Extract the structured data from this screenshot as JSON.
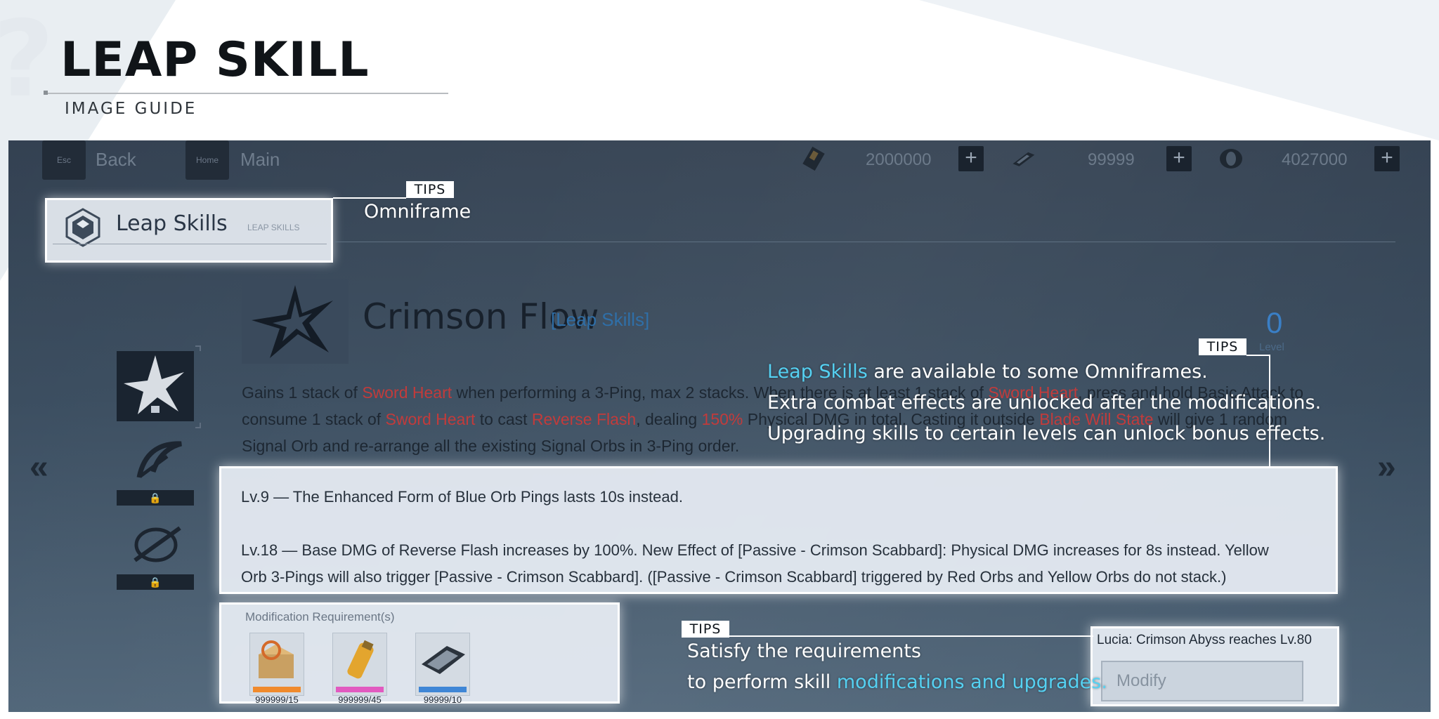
{
  "guide": {
    "title": "LEAP SKILL",
    "subtitle": "IMAGE GUIDE"
  },
  "topbar": {
    "back_key": "Esc",
    "back_label": "Back",
    "main_key": "Home",
    "main_label": "Main",
    "resources": [
      {
        "icon": "currency-card-icon",
        "value": "2000000"
      },
      {
        "icon": "currency-chip-icon",
        "value": "99999"
      },
      {
        "icon": "currency-coin-icon",
        "value": "4027000"
      }
    ]
  },
  "tab": {
    "label": "Leap Skills",
    "sublabel": "LEAP SKILLS"
  },
  "skill": {
    "name": "Crimson Flow",
    "tag": "[Leap Skills]",
    "level": "0",
    "level_label": "Level",
    "desc": {
      "p1": "Gains 1 stack of ",
      "k1": "Sword Heart",
      "p2": " when performing a 3-Ping, max 2 stacks. When there is at least 1 stack of ",
      "k2": "Sword Heart",
      "p3": ", press and hold Basic Attack to consume 1 stack of ",
      "k3": "Sword Heart",
      "p4": " to cast ",
      "k4": "Reverse Flash",
      "p5": ", dealing ",
      "k5": "150%",
      "p6": " Physical DMG in total. Casting it outside ",
      "k6": "Blade Will State",
      "p7": " will give 1 random Signal Orb and re-arrange all the existing Signal Orbs in 3-Ping order."
    },
    "upgrades": [
      "Lv.9 — The Enhanced Form of Blue Orb Pings lasts 10s instead.",
      "Lv.18 — Base DMG of Reverse Flash increases by 100%. New Effect of [Passive - Crimson Scabbard]: Physical DMG increases for 8s instead. Yellow",
      "Orb 3-Pings will also trigger [Passive - Crimson Scabbard]. ([Passive - Crimson Scabbard] triggered by Red Orbs and Yellow Orbs do not stack.)"
    ]
  },
  "requirements": {
    "title": "Modification Requirement(s)",
    "items": [
      {
        "icon": "material-crate-icon",
        "count": "999999/15",
        "stars_color": "#f08a2c"
      },
      {
        "icon": "material-canister-icon",
        "count": "999999/45",
        "stars_color": "#e15ac0"
      },
      {
        "icon": "material-module-icon",
        "count": "99999/10",
        "stars_color": "#3f86d6"
      }
    ]
  },
  "condition": {
    "text": "Lucia: Crimson Abyss reaches Lv.80",
    "modify_label": "Modify"
  },
  "tips": {
    "tag": "TIPS",
    "omniframe": "Omniframe",
    "leap_highlight": "Leap Skills",
    "leap_line1_rest": " are available to some Omniframes.",
    "leap_line2": "Extra combat effects are unlocked after the modifications.",
    "leap_line3": "Upgrading skills to certain levels can unlock bonus effects.",
    "req_line1": "Satisfy the requirements",
    "req_line2_prefix": "to perform skill ",
    "req_line2_highlight": "modifications and upgrades."
  },
  "colors": {
    "cyan_highlight": "#55d1f2",
    "keyword_red": "#c23b3b",
    "skill_tag_blue": "#2f6fa8"
  }
}
